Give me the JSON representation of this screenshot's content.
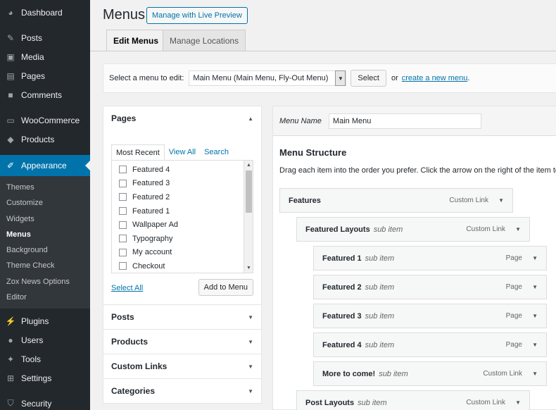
{
  "sidebar": {
    "items": [
      {
        "label": "Dashboard",
        "icon": "dashboard-icon"
      },
      {
        "label": "Posts",
        "icon": "pin-icon"
      },
      {
        "label": "Media",
        "icon": "media-icon"
      },
      {
        "label": "Pages",
        "icon": "pages-icon"
      },
      {
        "label": "Comments",
        "icon": "comment-icon"
      },
      {
        "label": "WooCommerce",
        "icon": "woo-icon"
      },
      {
        "label": "Products",
        "icon": "box-icon"
      },
      {
        "label": "Appearance",
        "icon": "brush-icon"
      }
    ],
    "appearance_sub": [
      "Themes",
      "Customize",
      "Widgets",
      "Menus",
      "Background",
      "Theme Check",
      "Zox News Options",
      "Editor"
    ],
    "bottom_items": [
      {
        "label": "Plugins",
        "icon": "plug-icon"
      },
      {
        "label": "Users",
        "icon": "user-icon"
      },
      {
        "label": "Tools",
        "icon": "wrench-icon"
      },
      {
        "label": "Settings",
        "icon": "settings-icon"
      },
      {
        "label": "Security",
        "icon": "shield-icon"
      }
    ]
  },
  "header": {
    "title": "Menus",
    "live_preview": "Manage with Live Preview"
  },
  "tabs": {
    "edit": "Edit Menus",
    "locations": "Manage Locations"
  },
  "select_bar": {
    "label": "Select a menu to edit:",
    "selected": "Main Menu (Main Menu, Fly-Out Menu)",
    "select_btn": "Select",
    "or": "or",
    "create_link": "create a new menu",
    "period": "."
  },
  "pages_box": {
    "title": "Pages",
    "tabs": [
      "Most Recent",
      "View All",
      "Search"
    ],
    "items": [
      "Featured 4",
      "Featured 3",
      "Featured 2",
      "Featured 1",
      "Wallpaper Ad",
      "Typography",
      "My account",
      "Checkout"
    ],
    "select_all": "Select All",
    "add_btn": "Add to Menu"
  },
  "accordions": [
    "Posts",
    "Products",
    "Custom Links",
    "Categories"
  ],
  "editor": {
    "name_label": "Menu Name",
    "name_value": "Main Menu",
    "structure_title": "Menu Structure",
    "structure_desc": "Drag each item into the order you prefer. Click the arrow on the right of the item to"
  },
  "menu_items": [
    {
      "title": "Features",
      "sub": "",
      "type": "Custom Link"
    },
    {
      "title": "Featured Layouts",
      "sub": "sub item",
      "type": "Custom Link"
    },
    {
      "title": "Featured 1",
      "sub": "sub item",
      "type": "Page"
    },
    {
      "title": "Featured 2",
      "sub": "sub item",
      "type": "Page"
    },
    {
      "title": "Featured 3",
      "sub": "sub item",
      "type": "Page"
    },
    {
      "title": "Featured 4",
      "sub": "sub item",
      "type": "Page"
    },
    {
      "title": "More to come!",
      "sub": "sub item",
      "type": "Custom Link"
    },
    {
      "title": "Post Layouts",
      "sub": "sub item",
      "type": "Custom Link"
    }
  ]
}
